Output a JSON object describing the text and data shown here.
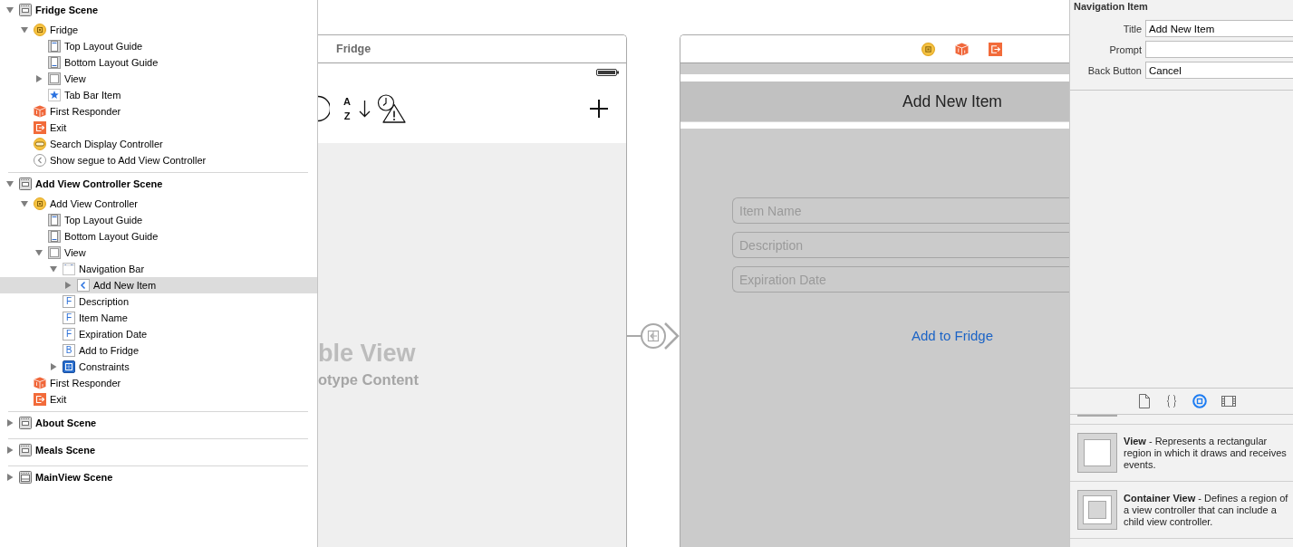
{
  "outline": {
    "scenes": [
      {
        "label": "Fridge Scene",
        "kind": "scene",
        "expanded": true,
        "selected": false,
        "children": [
          {
            "label": "Fridge",
            "kind": "controller",
            "expanded": true,
            "selected": false,
            "children": [
              {
                "label": "Top Layout Guide",
                "kind": "top-guide",
                "selected": false
              },
              {
                "label": "Bottom Layout Guide",
                "kind": "bottom-guide",
                "selected": false
              },
              {
                "label": "View",
                "kind": "view",
                "expanded": false,
                "selected": false
              },
              {
                "label": "Tab Bar Item",
                "kind": "tab-bar-item",
                "selected": false
              }
            ]
          },
          {
            "label": "First Responder",
            "kind": "first-responder",
            "selected": false
          },
          {
            "label": "Exit",
            "kind": "exit",
            "selected": false
          },
          {
            "label": "Search Display Controller",
            "kind": "search-controller",
            "selected": false
          },
          {
            "label": "Show segue to Add View Controller",
            "kind": "segue",
            "selected": false
          }
        ]
      },
      {
        "label": "Add View Controller Scene",
        "kind": "scene",
        "expanded": true,
        "selected": false,
        "children": [
          {
            "label": "Add View Controller",
            "kind": "controller",
            "expanded": true,
            "selected": false,
            "children": [
              {
                "label": "Top Layout Guide",
                "kind": "top-guide",
                "selected": false
              },
              {
                "label": "Bottom Layout Guide",
                "kind": "bottom-guide",
                "selected": false
              },
              {
                "label": "View",
                "kind": "view",
                "expanded": true,
                "selected": false,
                "children": [
                  {
                    "label": "Navigation Bar",
                    "kind": "nav-bar",
                    "expanded": true,
                    "selected": false,
                    "children": [
                      {
                        "label": "Add New Item",
                        "kind": "nav-item",
                        "expanded": false,
                        "selected": true
                      }
                    ]
                  },
                  {
                    "label": "Description",
                    "kind": "field",
                    "badge": "F",
                    "selected": false
                  },
                  {
                    "label": "Item Name",
                    "kind": "field",
                    "badge": "F",
                    "selected": false
                  },
                  {
                    "label": "Expiration Date",
                    "kind": "field",
                    "badge": "F",
                    "selected": false
                  },
                  {
                    "label": "Add to Fridge",
                    "kind": "button",
                    "badge": "B",
                    "selected": false
                  },
                  {
                    "label": "Constraints",
                    "kind": "constraints",
                    "expanded": false,
                    "selected": false
                  }
                ]
              }
            ]
          },
          {
            "label": "First Responder",
            "kind": "first-responder",
            "selected": false
          },
          {
            "label": "Exit",
            "kind": "exit",
            "selected": false
          }
        ]
      },
      {
        "label": "About Scene",
        "kind": "scene",
        "expanded": false,
        "selected": false
      },
      {
        "label": "Meals Scene",
        "kind": "scene",
        "expanded": false,
        "selected": false
      },
      {
        "label": "MainView Scene",
        "kind": "tab-scene",
        "expanded": false,
        "selected": false
      }
    ]
  },
  "canvas": {
    "table_scene": {
      "title": "Fridge",
      "sort_letters": [
        "A",
        "Z"
      ],
      "table_label": "ble View",
      "table_sublabel": "otype Content"
    },
    "form_scene": {
      "nav_title": "Add New Item",
      "fields": [
        {
          "placeholder": "Item Name"
        },
        {
          "placeholder": "Description"
        },
        {
          "placeholder": "Expiration Date"
        }
      ],
      "button": "Add to Fridge"
    }
  },
  "inspector": {
    "title": "Navigation Item",
    "fields": [
      {
        "label": "Title",
        "value": "Add New Item"
      },
      {
        "label": "Prompt"
      },
      {
        "label": "Back Button",
        "value": "Cancel"
      }
    ],
    "library_tabs": [
      {
        "kind": "file",
        "selected": false
      },
      {
        "kind": "code",
        "selected": false
      },
      {
        "kind": "object",
        "selected": true
      },
      {
        "kind": "media",
        "selected": false
      }
    ],
    "library_items": [
      {
        "kind": "view",
        "text": "**View** - Represents a rectangular region in which it draws and receives events."
      },
      {
        "kind": "container",
        "text": "**Container View** - Defines a region of a view controller that can include a child view controller."
      }
    ]
  }
}
